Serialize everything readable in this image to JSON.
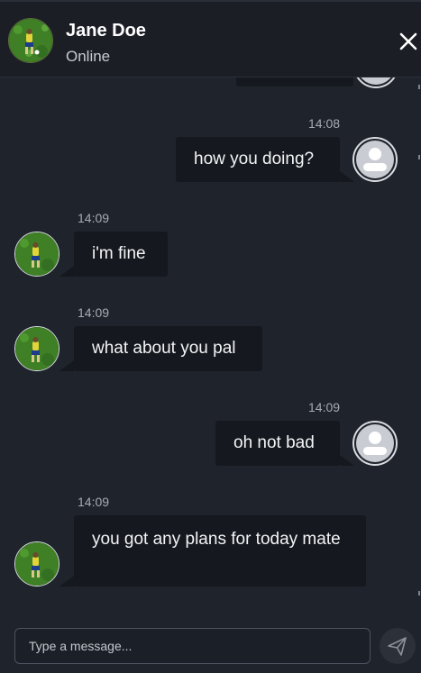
{
  "header": {
    "name": "Jane Doe",
    "status": "Online",
    "avatar_icon": "contact-photo-soccer-player",
    "close_icon": "close-icon"
  },
  "messages": [
    {
      "direction": "in",
      "time": "14:09",
      "text": "i'm fine"
    },
    {
      "direction": "in",
      "time": "14:09",
      "text": "what about you pal"
    },
    {
      "direction": "out",
      "time": "14:09",
      "text": "oh not bad"
    },
    {
      "direction": "in",
      "time": "14:09",
      "text": "you got any plans for today mate"
    }
  ],
  "messages_top": [
    {
      "direction": "out",
      "time": "14:08",
      "text": "how you doing?"
    }
  ],
  "composer": {
    "placeholder": "Type a message...",
    "send_icon": "send-icon"
  },
  "colors": {
    "background": "#1f232b",
    "bubble": "#15181e",
    "header": "#1b1e25",
    "timestamp": "#a6abb3"
  }
}
